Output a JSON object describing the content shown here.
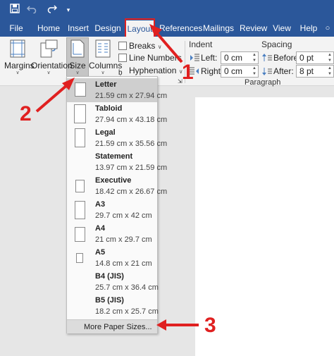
{
  "quick_access": {
    "save_icon": "save-icon",
    "undo_icon": "undo-icon",
    "redo_icon": "redo-icon",
    "customize_icon": "customize-qat-icon"
  },
  "tabs": [
    "File",
    "Home",
    "Insert",
    "Design",
    "Layout",
    "References",
    "Mailings",
    "Review",
    "View",
    "Help"
  ],
  "active_tab": "Layout",
  "ribbon": {
    "margins": "Margins",
    "orientation": "Orientation",
    "size": "Size",
    "columns": "Columns",
    "breaks": "Breaks",
    "line_numbers": "Line Numbers",
    "hyphenation": "Hyphenation",
    "indent": {
      "title": "Indent",
      "left_label": "Left:",
      "left_value": "0 cm",
      "right_label": "Right:",
      "right_value": "0 cm"
    },
    "spacing": {
      "title": "Spacing",
      "before_label": "Before:",
      "before_value": "0 pt",
      "after_label": "After:",
      "after_value": "8 pt"
    },
    "paragraph_group": "Paragraph"
  },
  "size_menu": {
    "items": [
      {
        "name": "Letter",
        "dims": "21.59 cm x 27.94 cm"
      },
      {
        "name": "Tabloid",
        "dims": "27.94 cm x 43.18 cm"
      },
      {
        "name": "Legal",
        "dims": "21.59 cm x 35.56 cm"
      },
      {
        "name": "Statement",
        "dims": "13.97 cm x 21.59 cm"
      },
      {
        "name": "Executive",
        "dims": "18.42 cm x 26.67 cm"
      },
      {
        "name": "A3",
        "dims": "29.7 cm x 42 cm"
      },
      {
        "name": "A4",
        "dims": "21 cm x 29.7 cm"
      },
      {
        "name": "A5",
        "dims": "14.8 cm x 21 cm"
      },
      {
        "name": "B4 (JIS)",
        "dims": "25.7 cm x 36.4 cm"
      },
      {
        "name": "B5 (JIS)",
        "dims": "18.2 cm x 25.7 cm"
      }
    ],
    "selected": "Letter",
    "more": "More Paper Sizes..."
  },
  "annotations": {
    "step1": "1",
    "step2": "2",
    "step3": "3",
    "color": "#e02020"
  },
  "colors": {
    "ribbon_blue": "#2b579a",
    "ribbon_bg": "#f3f3f3",
    "annotation_red": "#e02020"
  }
}
